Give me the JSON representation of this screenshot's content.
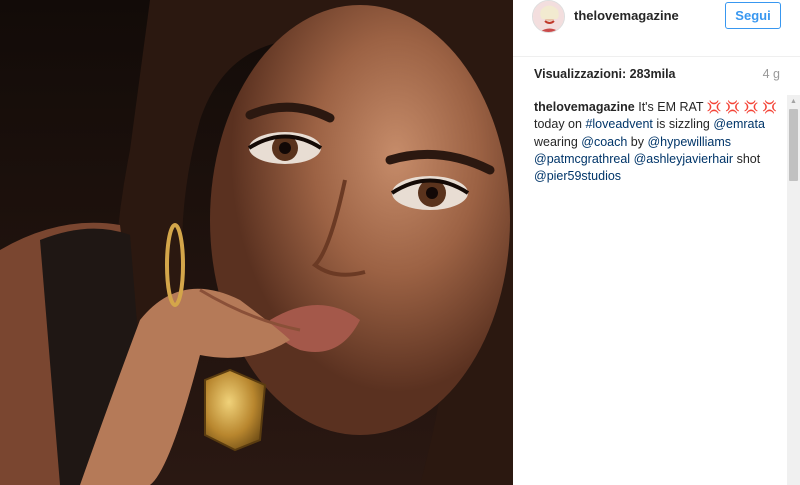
{
  "post": {
    "username": "thelovemagazine",
    "follow_label": "Segui",
    "views_label": "Visualizzazioni: 283mila",
    "age": "4 g"
  },
  "caption": {
    "author": "thelovemagazine",
    "text_1": "It's EM RAT",
    "emoji": "💢",
    "text_2": "today on",
    "hashtag": "#loveadvent",
    "text_3": "is sizzling",
    "mention_1": "@emrata",
    "text_4": "wearing",
    "mention_2": "@coach",
    "text_5": "by",
    "mention_3": "@hypewilliams",
    "mention_4": "@patmcgrathreal",
    "mention_5": "@ashleyjavierhair",
    "text_6": "shot",
    "mention_6": "@pier59studios"
  },
  "colors": {
    "accent": "#3897f0",
    "link": "#003569",
    "muted": "#999999"
  },
  "icons": [
    "avatar-image",
    "anger-emoji",
    "scroll-up-arrow"
  ]
}
